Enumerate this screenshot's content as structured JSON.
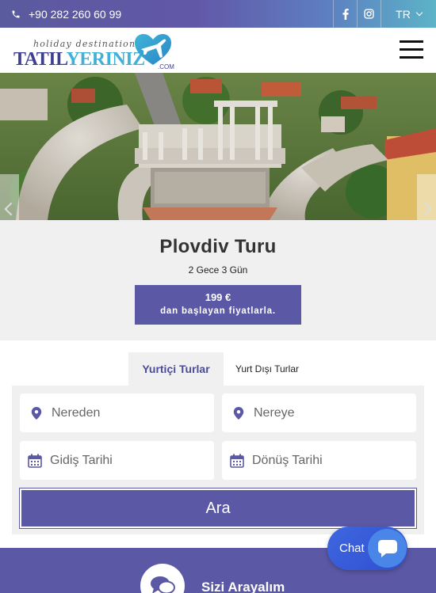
{
  "topbar": {
    "phone": "+90 282 260 60 99",
    "social": {
      "facebook_icon": "facebook-icon",
      "instagram_icon": "instagram-icon"
    },
    "language": "TR"
  },
  "header": {
    "logo": {
      "tagline": "holiday destination",
      "brand_part1": "TATIL",
      "brand_part2": "YERINIZ",
      "suffix": ".COM"
    }
  },
  "hero": {
    "image": "Plovdiv roman amphitheatre aerial photo"
  },
  "tour": {
    "title": "Plovdiv Turu",
    "duration": "2 Gece 3 Gün",
    "price": "199 €",
    "price_note": "dan başlayan fiyatlarla."
  },
  "search": {
    "tabs": [
      {
        "label": "Yurtiçi Turlar",
        "active": true
      },
      {
        "label": "Yurt Dışı Turlar",
        "active": false
      }
    ],
    "from_placeholder": "Nereden",
    "to_placeholder": "Nereye",
    "departure_placeholder": "Gidiş Tarihi",
    "return_placeholder": "Dönüş Tarihi",
    "button_label": "Ara"
  },
  "callback": {
    "title": "Sizi Arayalım"
  },
  "chat": {
    "label": "Chat"
  },
  "colors": {
    "accent": "#5b58a6",
    "topbar_start": "#5a5a9e",
    "topbar_end": "#5cb3c8",
    "panel": "#f0f0f0"
  }
}
